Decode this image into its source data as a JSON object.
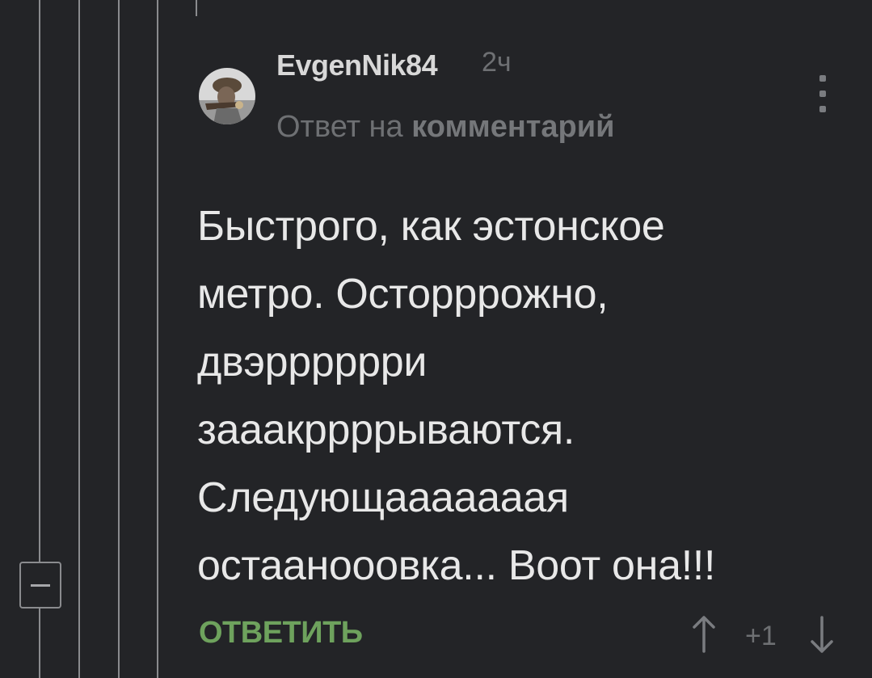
{
  "comment": {
    "author": "EvgenNik84",
    "time_ago": "2ч",
    "reply_prefix": "Ответ на",
    "reply_link": "комментарий",
    "avatar_icon": "user-avatar-photo",
    "more_icon": "more-vertical-icon",
    "body_lines": [
      "Быстрого, как эстонское",
      "метро. Осторррожно,",
      "двэрррррри",
      "зааакрррры­ваются.",
      "Следующааааааая",
      "остаанооовка... Воот она!!!"
    ],
    "reply_label": "ОТВЕТИТЬ",
    "rating": "+1",
    "upvote_icon": "arrow-up-icon",
    "downvote_icon": "arrow-down-icon"
  },
  "thread": {
    "collapse_icon": "minus-icon"
  },
  "colors": {
    "background": "#232427",
    "accent_green": "#6ea25d",
    "muted_text": "#6e7073",
    "thread_line": "#8a8b8e"
  }
}
